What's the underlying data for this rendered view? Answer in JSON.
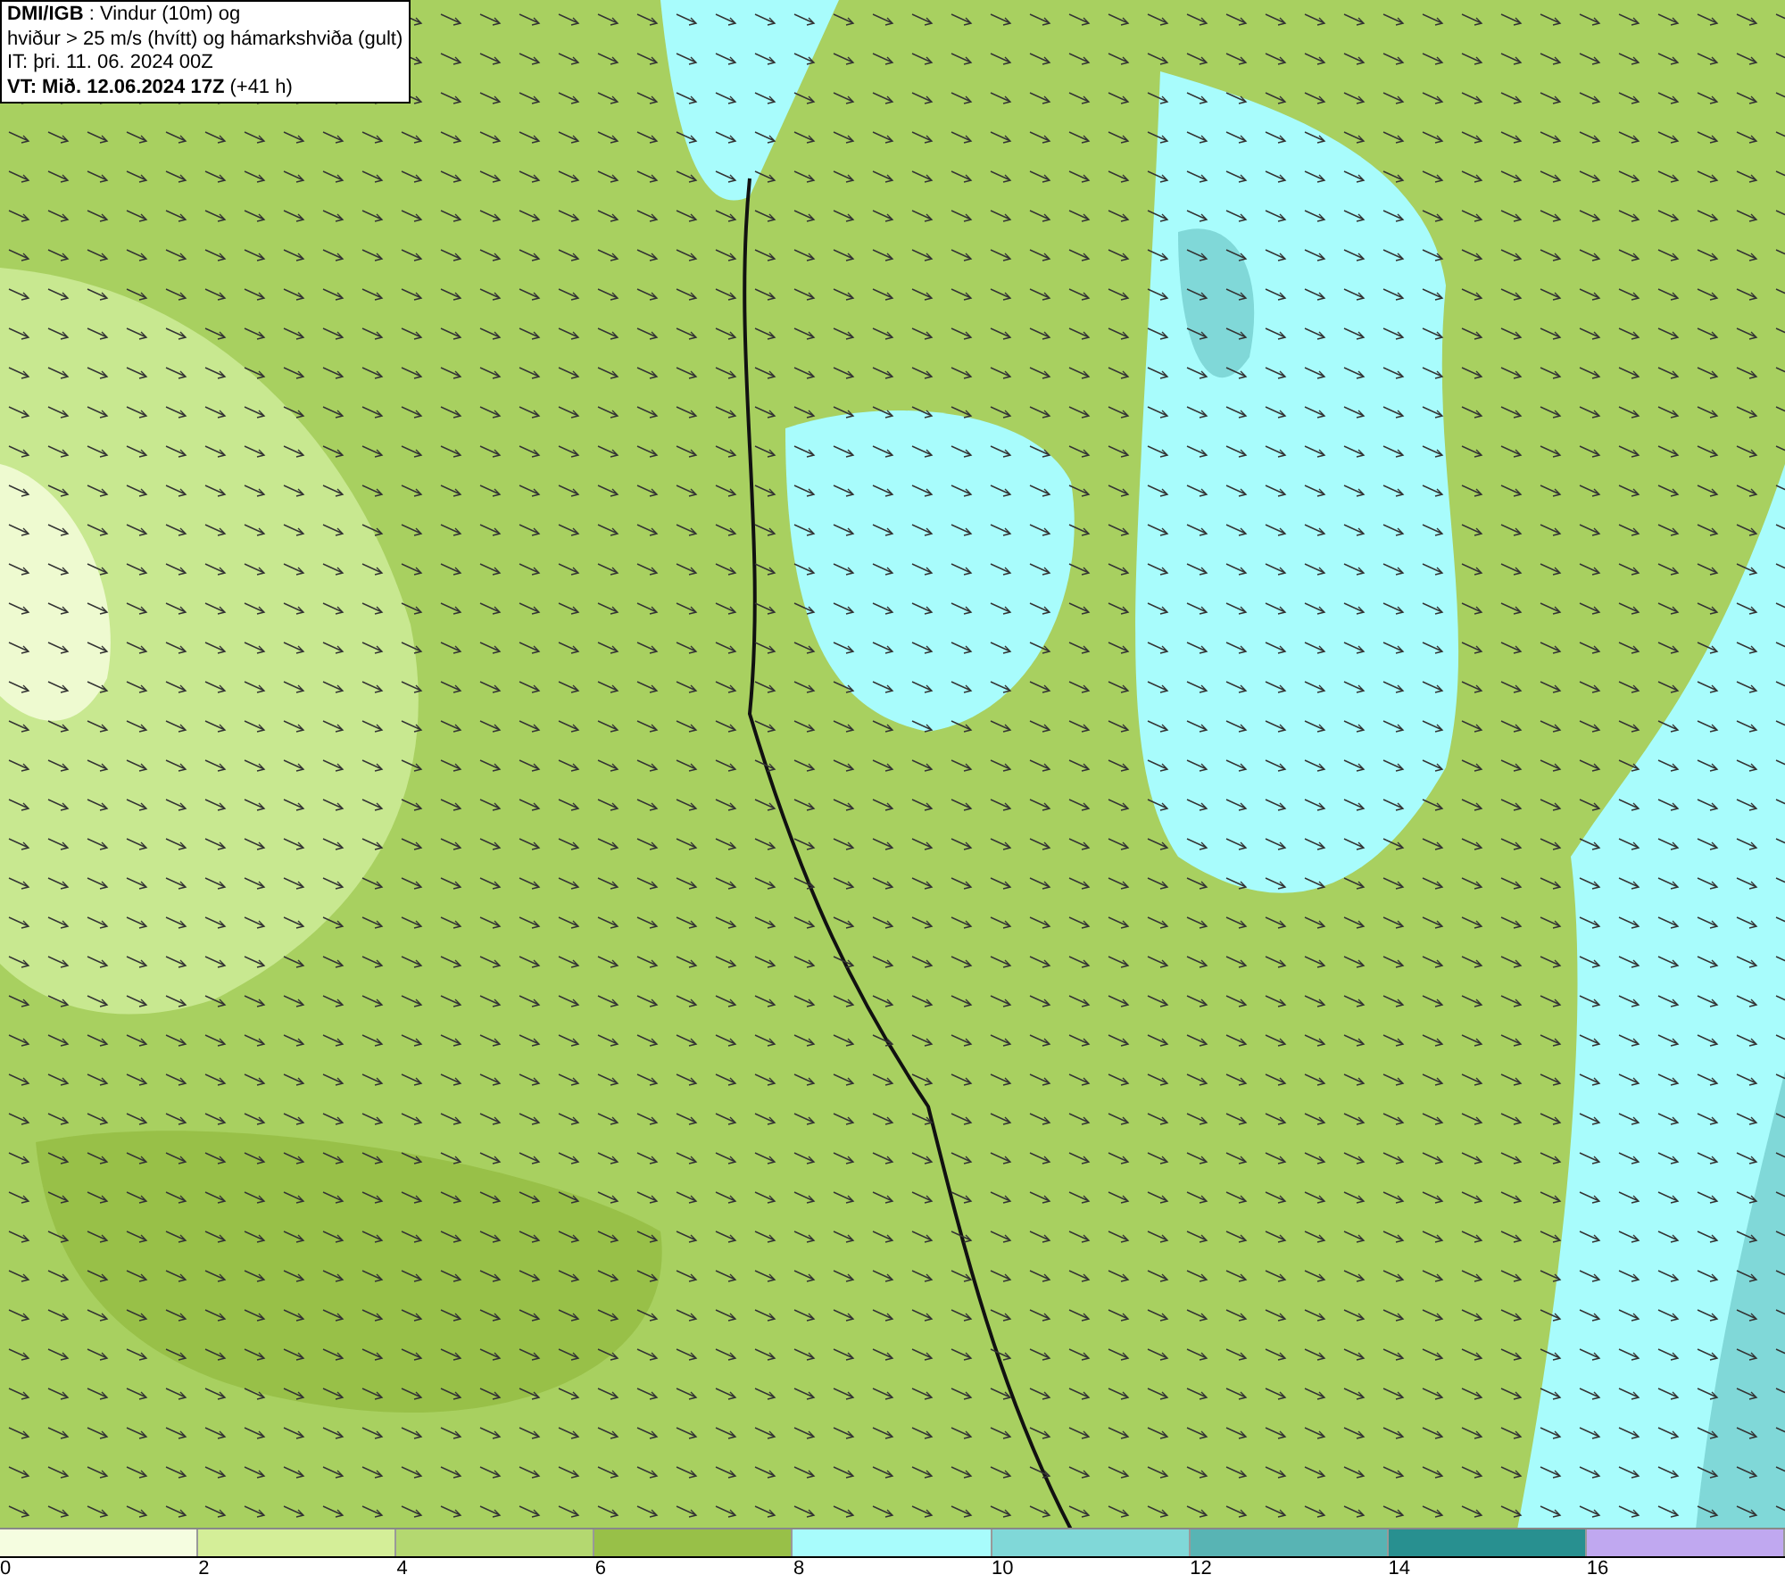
{
  "info_box": {
    "lines": [
      "**DMI/IGB** : Vindur (10m) og",
      "hviður > 25 m/s (hvítt) og hámarkshviða (gult)",
      "IT: þri. 11. 06. 2024 00Z",
      "**VT: Mið. 12.06.2024 17Z** (+41 h)"
    ]
  },
  "legend": {
    "bins": [
      {
        "color": "#f5fde0"
      },
      {
        "color": "#d4ee98"
      },
      {
        "color": "#b4d870"
      },
      {
        "color": "#98c048"
      },
      {
        "color": "#a8fcfc"
      },
      {
        "color": "#80d8d8"
      },
      {
        "color": "#58b4b4"
      },
      {
        "color": "#289090"
      },
      {
        "color": "#c0a8f0"
      }
    ],
    "ticks": [
      "0",
      "2",
      "4",
      "6",
      "8",
      "10",
      "12",
      "14",
      "16"
    ]
  }
}
